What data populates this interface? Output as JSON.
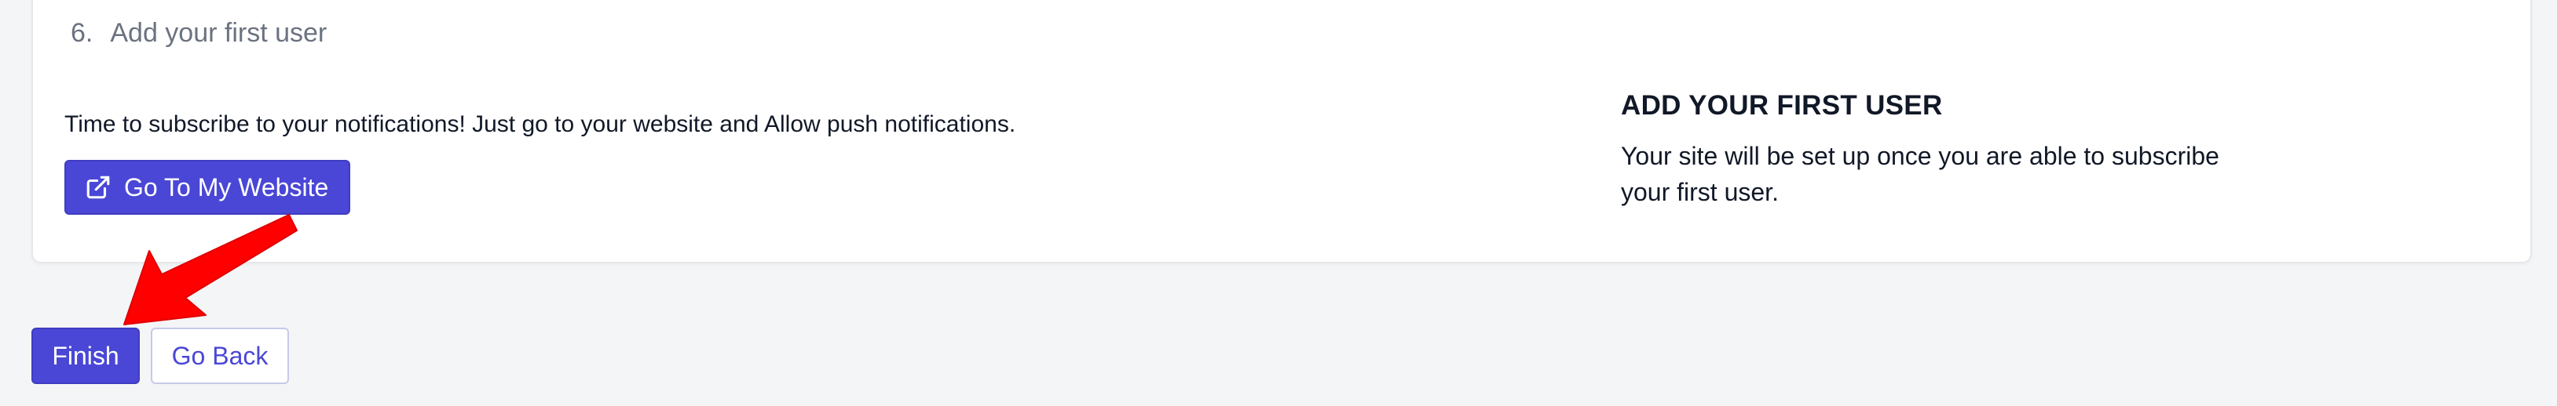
{
  "step": {
    "number": "6.",
    "title": "Add your first user"
  },
  "left": {
    "notification_text": "Time to subscribe to your notifications! Just go to your website and Allow push notifications.",
    "website_button_label": "Go To My Website",
    "website_button_icon": "external-link-icon"
  },
  "right": {
    "heading": "ADD YOUR FIRST USER",
    "body": "Your site will be set up once you are able to subscribe your first user."
  },
  "footer": {
    "finish_label": "Finish",
    "go_back_label": "Go Back"
  },
  "colors": {
    "primary": "#4a47d6",
    "annotation_arrow": "#ff0000",
    "background": "#f4f5f7"
  }
}
